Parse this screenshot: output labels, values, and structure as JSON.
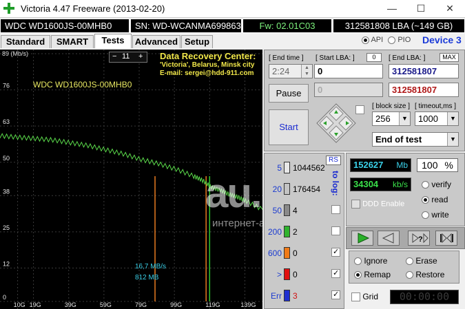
{
  "window": {
    "title": "Victoria 4.47  Freeware (2013-02-20)",
    "minimize": "—",
    "maximize": "☐",
    "close": "✕"
  },
  "info": {
    "model": "WDC WD1600JS-00MHB0",
    "serial": "SN: WD-WCANMA699863",
    "firmware": "Fw: 02.01C03",
    "capacity": "312581808 LBA (~149 GB)"
  },
  "tabs": [
    "Standard",
    "SMART",
    "Tests",
    "Advanced",
    "Setup"
  ],
  "api": {
    "api_label": "API",
    "pio_label": "PIO",
    "device_label": "Device 3"
  },
  "graph": {
    "y_unit": "(Mb/s)",
    "y_ticks": [
      "89",
      "76",
      "63",
      "50",
      "38",
      "25",
      "12",
      "0"
    ],
    "x_ticks": [
      "10G",
      "19G",
      "39G",
      "59G",
      "79G",
      "99G",
      "119G",
      "139G"
    ],
    "step_value": "11",
    "minus": "−",
    "plus": "+",
    "drive_label": "WDC WD1600JS-00MHB0",
    "promo_title": "Data Recovery Center:",
    "promo_line2": "'Victoria', Belarus, Minsk city",
    "promo_line3": "E-mail: sergei@hdd-911.com",
    "speed_readout": "16,7 MB/s",
    "pos_readout": "812 MB",
    "watermark": "au.ru",
    "watermark_sub": "интернет-аукцион"
  },
  "chart_data": {
    "type": "line",
    "xlabel": "",
    "ylabel": "(Mb/s)",
    "x_unit": "GB",
    "xlim": [
      0,
      149
    ],
    "ylim": [
      0,
      89
    ],
    "x": [
      0,
      10,
      20,
      30,
      40,
      50,
      60,
      70,
      80,
      90,
      100,
      110,
      115,
      120,
      125,
      130,
      135,
      140,
      149
    ],
    "series": [
      {
        "name": "",
        "values": [
          59.5,
          59,
          58.5,
          58,
          57,
          56,
          54.5,
          53,
          51,
          49.5,
          47.5,
          45,
          43.5,
          41,
          40,
          38.5,
          37.5,
          36,
          33
        ]
      }
    ],
    "spikes": [
      {
        "x": 88,
        "color": "#e87a20"
      },
      {
        "x": 117,
        "color": "#e87a20"
      },
      {
        "x": 119,
        "color": "#2ec82e"
      }
    ]
  },
  "controls": {
    "end_time_label": "[ End time ]",
    "end_time_value": "2:24",
    "start_lba_label": "[ Start LBA: ]",
    "start_lba_counter": "0",
    "start_lba_value": "0",
    "end_lba_label": "[ End LBA: ]",
    "end_lba_max": "MAX",
    "end_lba_value": "312581807",
    "pause": "Pause",
    "current_lba": "0",
    "current_end": "312581807",
    "start": "Start",
    "block_size_label": "[ block size ]",
    "block_size_value": "256",
    "timeout_label": "[ timeout,ms ]",
    "timeout_value": "1000",
    "end_action": "End of test"
  },
  "legend": {
    "rs": "RS",
    "to_log": "to log:",
    "rows": [
      {
        "label": "5",
        "count": "1044562",
        "color": "#e8e8e8",
        "check": false
      },
      {
        "label": "20",
        "count": "176454",
        "color": "#c4c4c4",
        "check": false
      },
      {
        "label": "50",
        "count": "4",
        "color": "#8a8a8a",
        "check": false
      },
      {
        "label": "200",
        "count": "2",
        "color": "#2fb32f",
        "check": false
      },
      {
        "label": "600",
        "count": "0",
        "color": "#f07a18",
        "check": true
      },
      {
        "label": ">",
        "count": "0",
        "color": "#e01010",
        "check": true
      },
      {
        "label": "Err",
        "count": "3",
        "color": "#1f2fd0",
        "check": true
      }
    ]
  },
  "stats": {
    "mb_value": "152627",
    "mb_unit": "Mb",
    "percent": "100",
    "percent_unit": "%",
    "speed_value": "34304",
    "speed_unit": "kb/s",
    "ddd_enable": "DDD Enable",
    "verify": "verify",
    "read": "read",
    "write": "write",
    "ignore": "Ignore",
    "erase": "Erase",
    "remap": "Remap",
    "restore": "Restore",
    "grid": "Grid",
    "timer": "00:00:00"
  }
}
